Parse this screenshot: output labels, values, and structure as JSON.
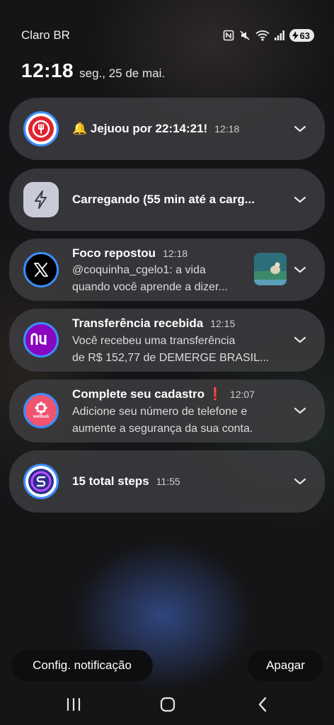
{
  "status_bar": {
    "carrier": "Claro BR",
    "battery_level": "63"
  },
  "clock": {
    "time": "12:18",
    "date": "seg., 25 de mai."
  },
  "notifications": [
    {
      "app_icon": "fork-knife-icon",
      "title": "🔔 Jejuou por 22:14:21!",
      "time": "12:18",
      "body": []
    },
    {
      "app_icon": "lightning-bolt-icon",
      "title": "Carregando (55 min até a carg...",
      "time": "",
      "body": []
    },
    {
      "app_icon": "x-logo-icon",
      "title": "Foco repostou",
      "time": "12:18",
      "body": [
        "@coquinha_cgelo1: a vida",
        "quando você aprende a dizer..."
      ],
      "has_thumbnail": true
    },
    {
      "app_icon": "nubank-logo-icon",
      "title": "Transferência recebida",
      "time": "12:15",
      "body": [
        "Você recebeu uma transferência",
        "de R$ 152,77 de DEMERGE BRASIL..."
      ]
    },
    {
      "app_icon": "wellhub-logo-icon",
      "title": "Complete seu cadastro ❗",
      "time": "12:07",
      "body": [
        "Adicione seu número de telefone e",
        "aumente a segurança da sua conta."
      ],
      "icon_text": "wellhub"
    },
    {
      "app_icon": "samsung-health-steps-icon",
      "title": "15 total steps",
      "time": "11:55",
      "body": []
    }
  ],
  "actions": {
    "settings_label": "Config. notificação",
    "clear_label": "Apagar"
  },
  "colors": {
    "ring_blue": "#3b8dff",
    "nubank_purple": "#8a05be",
    "wellhub_pink": "#f0546f",
    "fasting_red": "#e0242f"
  }
}
